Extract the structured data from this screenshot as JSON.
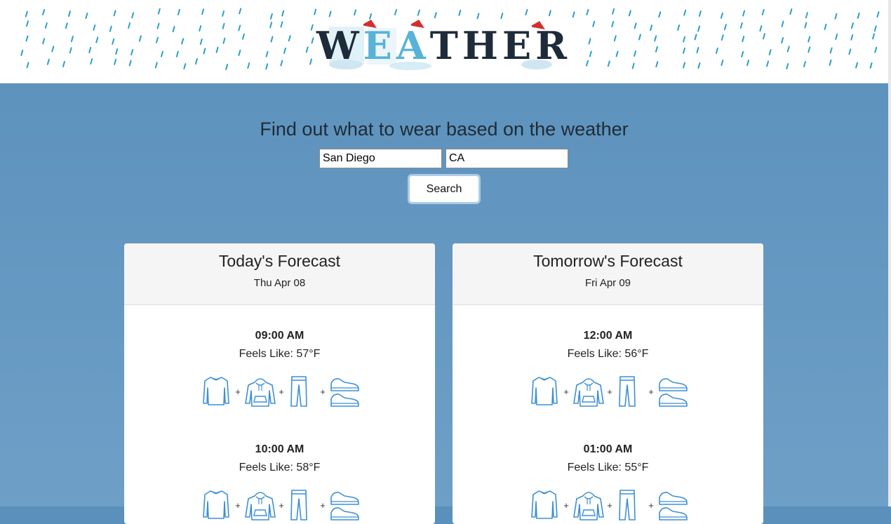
{
  "header": {
    "logo_text": "WEATHER"
  },
  "search": {
    "heading": "Find out what to wear based on the weather",
    "city_value": "San Diego",
    "state_value": "CA",
    "button_label": "Search"
  },
  "forecasts": [
    {
      "title": "Today's Forecast",
      "date": "Thu Apr 08",
      "slots": [
        {
          "time": "09:00 AM",
          "feels_like": "Feels Like: 57°F",
          "outfit": [
            "long-sleeve-shirt-icon",
            "hoodie-icon",
            "pants-icon",
            "sneakers-icon"
          ]
        },
        {
          "time": "10:00 AM",
          "feels_like": "Feels Like: 58°F",
          "outfit": [
            "long-sleeve-shirt-icon",
            "hoodie-icon",
            "pants-icon",
            "sneakers-icon"
          ]
        }
      ]
    },
    {
      "title": "Tomorrow's Forecast",
      "date": "Fri Apr 09",
      "slots": [
        {
          "time": "12:00 AM",
          "feels_like": "Feels Like: 56°F",
          "outfit": [
            "long-sleeve-shirt-icon",
            "hoodie-icon",
            "pants-icon",
            "sneakers-icon"
          ]
        },
        {
          "time": "01:00 AM",
          "feels_like": "Feels Like: 55°F",
          "outfit": [
            "long-sleeve-shirt-icon",
            "hoodie-icon",
            "pants-icon",
            "sneakers-icon"
          ]
        }
      ]
    }
  ],
  "colors": {
    "background_top": "#5a90bb",
    "background_bottom": "#6e9fc7",
    "icon_blue": "#3c8fd6",
    "rain_blue": "#2aa0c8"
  }
}
